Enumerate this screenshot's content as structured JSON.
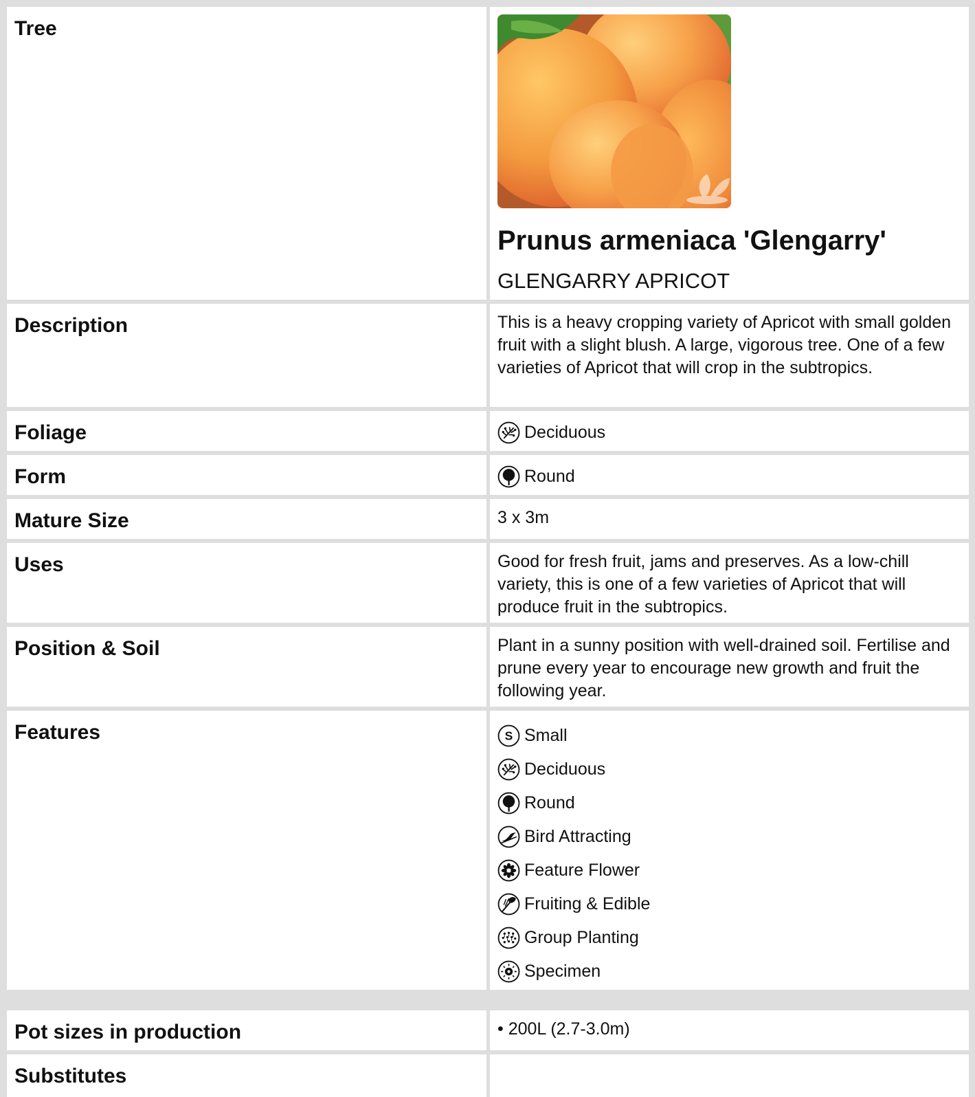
{
  "tree": {
    "label": "Tree",
    "botanical_name": "Prunus armeniaca 'Glengarry'",
    "common_name": "GLENGARRY APRICOT"
  },
  "description": {
    "label": "Description",
    "value": "This is a heavy cropping variety of Apricot with small golden fruit with a slight blush. A large, vigorous tree. One of a few varieties of Apricot that will crop in the subtropics."
  },
  "foliage": {
    "label": "Foliage",
    "icon": "deciduous-icon",
    "value": "Deciduous"
  },
  "form": {
    "label": "Form",
    "icon": "round-icon",
    "value": "Round"
  },
  "mature_size": {
    "label": "Mature Size",
    "value": "3 x 3m"
  },
  "uses": {
    "label": "Uses",
    "value": "Good for fresh fruit, jams and preserves. As a low-chill variety, this is one of a few varieties of Apricot that will produce fruit in the subtropics."
  },
  "position_soil": {
    "label": "Position & Soil",
    "value": "Plant in a sunny position with well-drained soil. Fertilise and prune every year to encourage new growth and fruit the following year."
  },
  "features": {
    "label": "Features",
    "items": [
      {
        "icon": "small-icon",
        "label": "Small"
      },
      {
        "icon": "deciduous-icon",
        "label": "Deciduous"
      },
      {
        "icon": "round-icon",
        "label": "Round"
      },
      {
        "icon": "bird-icon",
        "label": "Bird Attracting"
      },
      {
        "icon": "flower-icon",
        "label": "Feature Flower"
      },
      {
        "icon": "edible-icon",
        "label": "Fruiting & Edible"
      },
      {
        "icon": "group-planting-icon",
        "label": "Group Planting"
      },
      {
        "icon": "specimen-icon",
        "label": "Specimen"
      }
    ]
  },
  "pot_sizes": {
    "label": "Pot sizes in production",
    "items": [
      "• 200L (2.7-3.0m)"
    ]
  },
  "substitutes": {
    "label": "Substitutes",
    "value": ""
  }
}
